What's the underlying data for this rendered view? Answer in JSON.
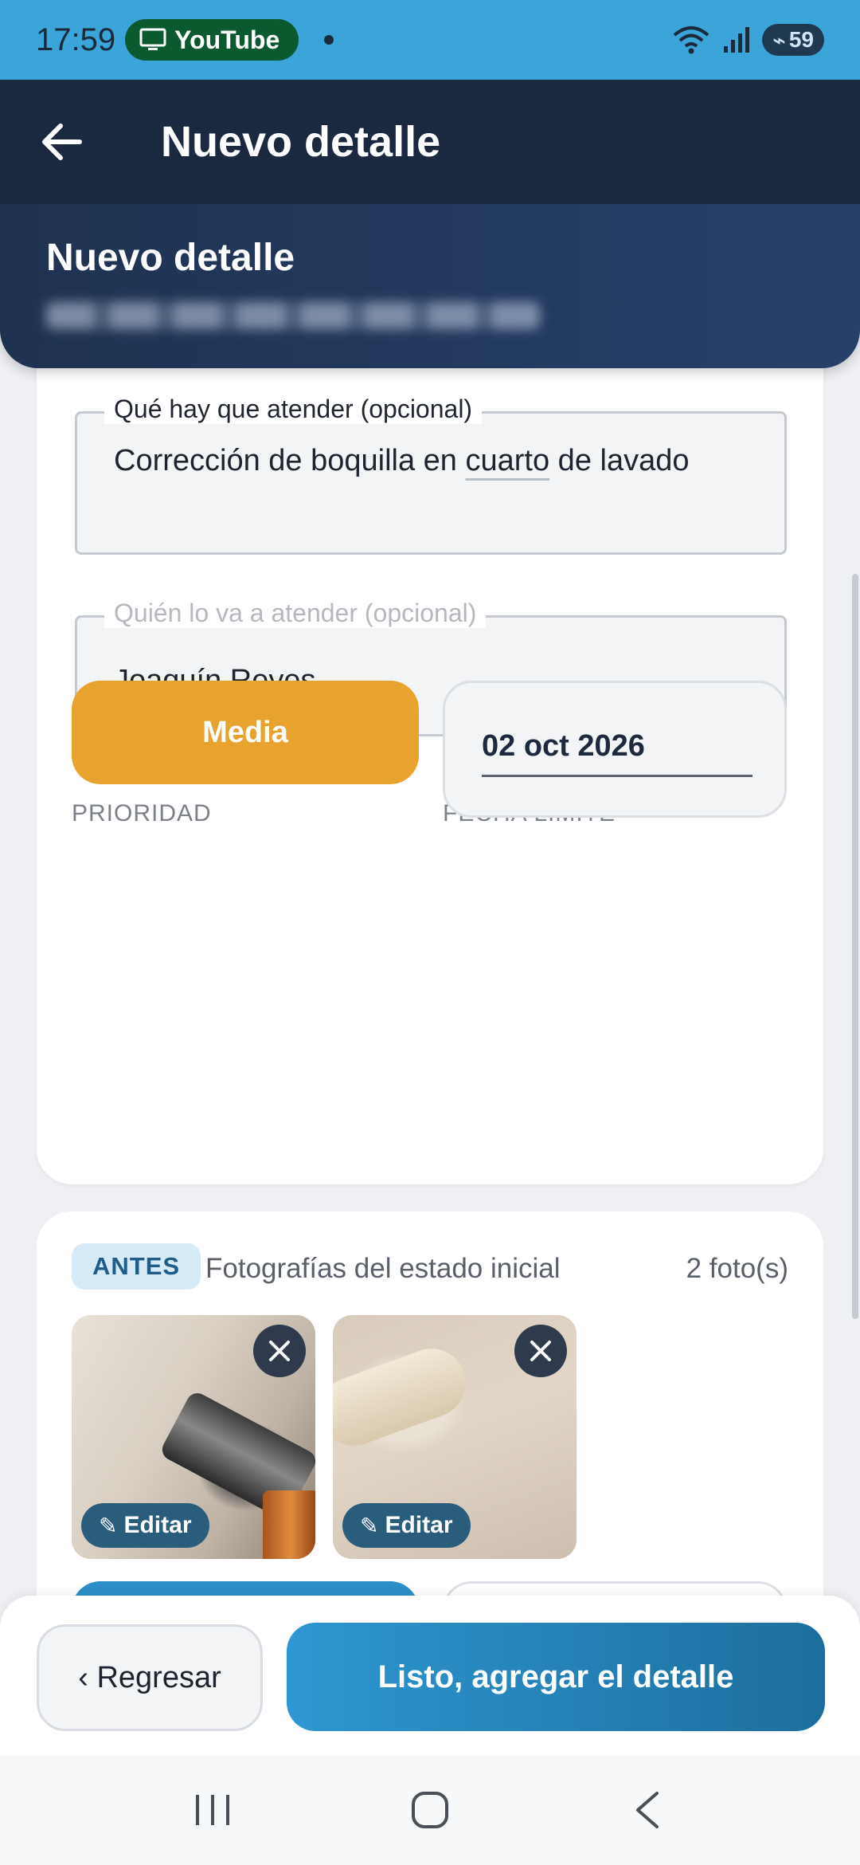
{
  "status_bar": {
    "time": "17:59",
    "app_pill": "YouTube",
    "battery": "59"
  },
  "app_bar": {
    "title": "Nuevo detalle"
  },
  "header": {
    "title": "Nuevo detalle"
  },
  "form": {
    "what_field": {
      "label": "Qué hay que atender (opcional)",
      "value_part1": "Corrección de boquilla en ",
      "value_underlined": "cuarto",
      "value_part2": " de lavado"
    },
    "who_field": {
      "label": "Quién lo va a atender (opcional)",
      "value": "Joaquín Reyes"
    },
    "priority": {
      "label": "PRIORIDAD",
      "value": "Media",
      "color": "#e8a22e"
    },
    "deadline": {
      "label": "FECHA LÍMITE",
      "value": "02 oct 2026"
    }
  },
  "photos": {
    "badge": "ANTES",
    "description": "Fotografías del estado inicial",
    "count": "2 foto(s)",
    "items": [
      {
        "edit_label": "Editar"
      },
      {
        "edit_label": "Editar"
      }
    ]
  },
  "actions": {
    "back_label": "‹ Regresar",
    "primary_label": "Listo, agregar el detalle"
  },
  "colors": {
    "status_bar": "#3ba4d8",
    "app_bar": "#1a2840",
    "accent": "#2e97d1"
  }
}
